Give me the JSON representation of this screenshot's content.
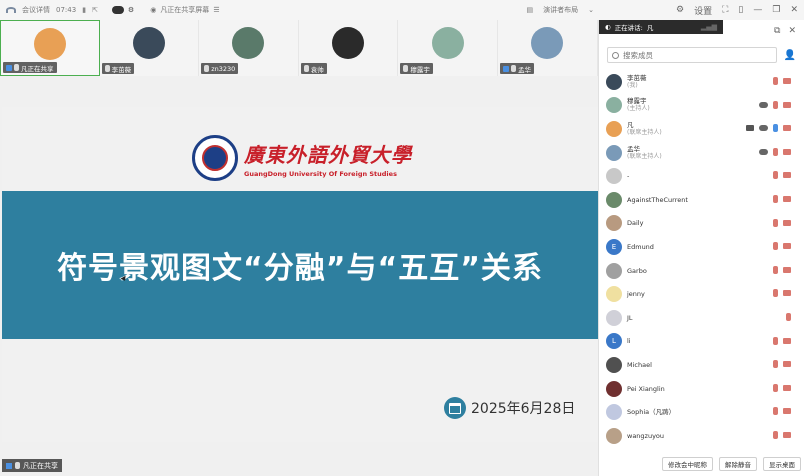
{
  "topbar": {
    "meeting_label": "会议详情",
    "time": "07:43",
    "sharing_label": "凡正在共享屏幕",
    "view_label": "演讲者布局",
    "settings_label": "设置"
  },
  "thumbnails": [
    {
      "name": "凡正在共享",
      "active": true,
      "avatar_color": "#e8a055"
    },
    {
      "name": "李茁薇",
      "active": false,
      "avatar_color": "#3a4a5a"
    },
    {
      "name": "zn3230",
      "active": false,
      "avatar_color": "#5a7a6a"
    },
    {
      "name": "袁帅",
      "active": false,
      "avatar_color": "#2a2a2a"
    },
    {
      "name": "穆露宇",
      "active": false,
      "avatar_color": "#8ab0a0"
    },
    {
      "name": "孟华",
      "active": false,
      "avatar_color": "#7a9ab8"
    }
  ],
  "slide": {
    "university_cn": "廣東外語外貿大學",
    "university_en": "GuangDong University Of Foreign Studies",
    "title": "符号景观图文“分融”与“五互”关系",
    "date": "2025年6月28日"
  },
  "bottom_label": "凡正在共享",
  "panel": {
    "speaking_label": "正在讲话:",
    "speaking_name": "凡",
    "search_placeholder": "搜索成员",
    "members": [
      {
        "name": "李茁薇",
        "role": "(我)",
        "color": "#3a4a5a",
        "initial": ""
      },
      {
        "name": "穆露宇",
        "role": "(主持人)",
        "color": "#8ab0a0",
        "initial": ""
      },
      {
        "name": "凡",
        "role": "(联席主持人)",
        "color": "#e8a055",
        "initial": ""
      },
      {
        "name": "孟华",
        "role": "(联席主持人)",
        "color": "#7a9ab8",
        "initial": ""
      },
      {
        "name": "-",
        "role": "",
        "color": "#c8c8c8",
        "initial": ""
      },
      {
        "name": "AgainstTheCurrent",
        "role": "",
        "color": "#6a8a6a",
        "initial": ""
      },
      {
        "name": "Daily",
        "role": "",
        "color": "#b89a80",
        "initial": ""
      },
      {
        "name": "Edmund",
        "role": "",
        "color": "#3a78c8",
        "initial": "E"
      },
      {
        "name": "Garbo",
        "role": "",
        "color": "#a0a0a0",
        "initial": ""
      },
      {
        "name": "jenny",
        "role": "",
        "color": "#f0e0a0",
        "initial": ""
      },
      {
        "name": "JL",
        "role": "",
        "color": "#d0d0d8",
        "initial": ""
      },
      {
        "name": "li",
        "role": "",
        "color": "#3a78c8",
        "initial": "L"
      },
      {
        "name": "Michael",
        "role": "",
        "color": "#505050",
        "initial": ""
      },
      {
        "name": "Pei Xianglin",
        "role": "",
        "color": "#703030",
        "initial": ""
      },
      {
        "name": "Sophia（凡踌）",
        "role": "",
        "color": "#c0c8e0",
        "initial": ""
      },
      {
        "name": "wangzuyou",
        "role": "",
        "color": "#b8a088",
        "initial": ""
      }
    ],
    "footer": {
      "rename_label": "修改会中昵称",
      "unmute_label": "解除静音",
      "show_desktop_label": "显示桌面"
    }
  }
}
